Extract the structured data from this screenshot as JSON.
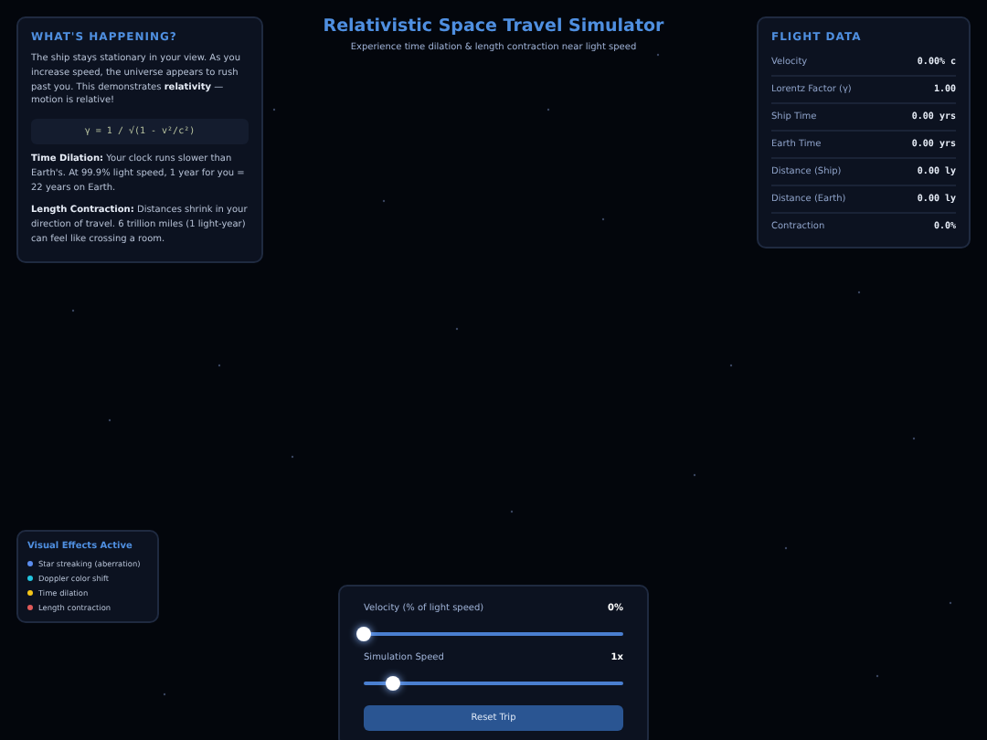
{
  "title": "Relativistic Space Travel Simulator",
  "subtitle": "Experience time dilation & length contraction near light speed",
  "info": {
    "heading": "WHAT'S HAPPENING?",
    "paragraphs": [
      {
        "kind": "text",
        "text": "The ship stays stationary in your view. As you increase speed, the universe appears to rush past you. This demonstrates **relativity** — motion is relative!"
      },
      {
        "kind": "formula",
        "text": "γ = 1 / √(1 - v²/c²)"
      },
      {
        "kind": "text",
        "text": "**Time Dilation:** Your clock runs slower than Earth's. At 99.9% light speed, 1 year for you = 22 years on Earth."
      },
      {
        "kind": "text",
        "text": "**Length Contraction:** Distances shrink in your direction of travel. 6 trillion miles (1 light-year) can feel like crossing a room."
      }
    ]
  },
  "flight_data": {
    "heading": "FLIGHT DATA",
    "rows": [
      {
        "label": "Velocity",
        "value": "0.00% c"
      },
      {
        "label": "Lorentz Factor (γ)",
        "value": "1.00"
      },
      {
        "label": "Ship Time",
        "value": "0.00 yrs"
      },
      {
        "label": "Earth Time",
        "value": "0.00 yrs"
      },
      {
        "label": "Distance (Ship)",
        "value": "0.00 ly"
      },
      {
        "label": "Distance (Earth)",
        "value": "0.00 ly"
      },
      {
        "label": "Contraction",
        "value": "0.0%"
      }
    ]
  },
  "effects": {
    "heading": "Visual Effects Active",
    "items": [
      {
        "label": "Star streaking (aberration)",
        "color": "#5b8def"
      },
      {
        "label": "Doppler color shift",
        "color": "#22c5e0"
      },
      {
        "label": "Time dilation",
        "color": "#f5c518"
      },
      {
        "label": "Length contraction",
        "color": "#e05a5a"
      }
    ]
  },
  "controls": {
    "sliders": [
      {
        "label": "Velocity (% of light speed)",
        "reading": "0%",
        "level": 0
      },
      {
        "label": "Simulation Speed",
        "reading": "1x",
        "level": 0.11
      }
    ],
    "button": "Reset Trip"
  }
}
